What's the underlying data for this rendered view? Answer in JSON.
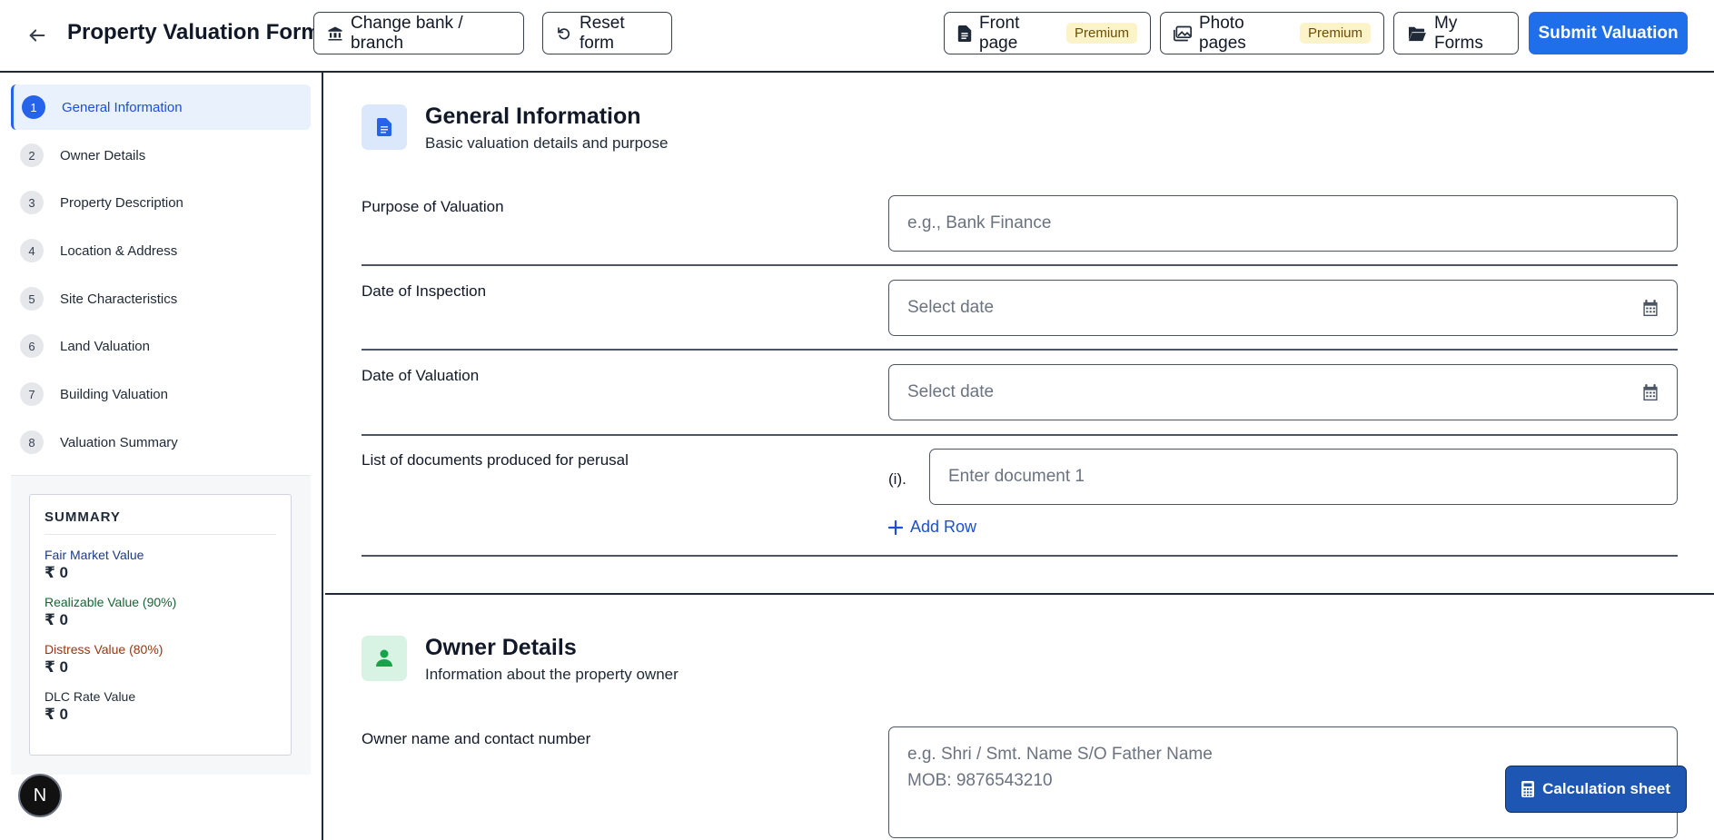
{
  "header": {
    "title": "Property Valuation Form",
    "change_bank": "Change bank / branch",
    "reset": "Reset form",
    "front_page": "Front page",
    "photo_pages": "Photo pages",
    "premium": "Premium",
    "my_forms": "My Forms",
    "submit": "Submit Valuation"
  },
  "sidebar": {
    "steps": [
      {
        "num": "1",
        "label": "General Information"
      },
      {
        "num": "2",
        "label": "Owner Details"
      },
      {
        "num": "3",
        "label": "Property Description"
      },
      {
        "num": "4",
        "label": "Location & Address"
      },
      {
        "num": "5",
        "label": "Site Characteristics"
      },
      {
        "num": "6",
        "label": "Land Valuation"
      },
      {
        "num": "7",
        "label": "Building Valuation"
      },
      {
        "num": "8",
        "label": "Valuation Summary"
      }
    ],
    "summary": {
      "heading": "SUMMARY",
      "items": [
        {
          "label": "Fair Market Value",
          "value": "₹ 0",
          "color": "#1e3a8a"
        },
        {
          "label": "Realizable Value (90%)",
          "value": "₹ 0",
          "color": "#166534"
        },
        {
          "label": "Distress Value (80%)",
          "value": "₹ 0",
          "color": "#9a3412"
        },
        {
          "label": "DLC Rate Value",
          "value": "₹ 0",
          "color": "#1f2937"
        }
      ]
    },
    "avatar_letter": "N"
  },
  "general": {
    "title": "General Information",
    "subtitle": "Basic valuation details and purpose",
    "purpose_label": "Purpose of Valuation",
    "purpose_placeholder": "e.g., Bank Finance",
    "inspection_label": "Date of Inspection",
    "inspection_placeholder": "Select date",
    "valuation_label": "Date of Valuation",
    "valuation_placeholder": "Select date",
    "documents_label": "List of documents produced for perusal",
    "doc_index": "(i).",
    "doc_placeholder": "Enter document 1",
    "add_row": "Add Row"
  },
  "owner": {
    "title": "Owner Details",
    "subtitle": "Information about the property owner",
    "name_label": "Owner name and contact number",
    "name_placeholder_line1": "e.g. Shri / Smt. Name S/O Father Name",
    "name_placeholder_line2": "MOB: 9876543210"
  },
  "calc_button": "Calculation sheet",
  "colors": {
    "accent": "#1f6feb",
    "premium_bg": "#fdf3c8"
  }
}
